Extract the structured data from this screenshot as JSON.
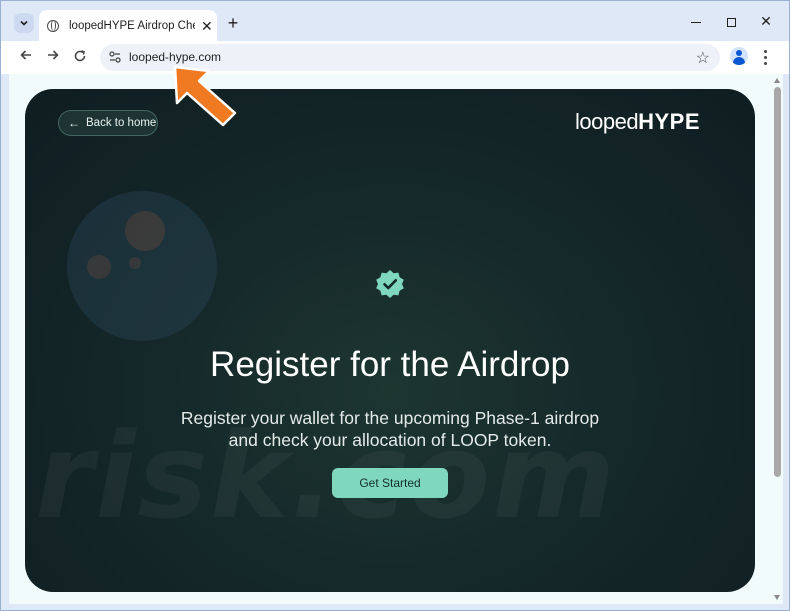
{
  "browser": {
    "tab_title": "loopedHYPE Airdrop Checker",
    "tab_close": "✕",
    "new_tab": "+",
    "close": "✕",
    "url": "looped-hype.com",
    "star": "☆"
  },
  "page": {
    "back_label": "Back to home",
    "logo_light": "looped",
    "logo_bold": "HYPE",
    "title": "Register for the Airdrop",
    "subtitle_line1": "Register your wallet for the upcoming Phase-1 airdrop",
    "subtitle_line2": "and check your allocation of LOOP token.",
    "cta_label": "Get Started"
  },
  "watermark": {
    "text": "risk.com"
  },
  "colors": {
    "accent": "#7fd8be",
    "card_bg": "#15282a",
    "annotation": "#f07a22"
  }
}
